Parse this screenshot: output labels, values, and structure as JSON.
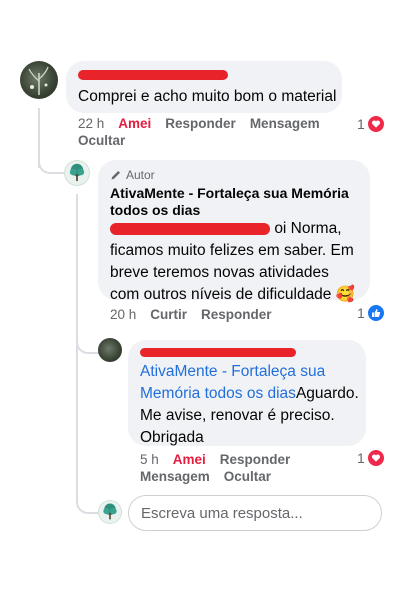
{
  "comment1": {
    "text": "Comprei e acho muito bom o material",
    "time": "22 h",
    "like_label": "Amei",
    "reply_label": "Responder",
    "message_label": "Mensagem",
    "hide_label": "Ocultar",
    "reaction_count": "1",
    "reaction_icon": "love-icon"
  },
  "reply1": {
    "badge": "Autor",
    "badge_icon": "pencil-icon",
    "author": "AtivaMente - Fortaleça sua Memória todos os dias",
    "text_line1": "oi Norma,",
    "text_rest": "ficamos muito felizes em saber. Em breve teremos novas atividades com outros níveis de dificuldade",
    "emoji": "🥰",
    "time": "20 h",
    "like_label": "Curtir",
    "reply_label": "Responder",
    "reaction_count": "1",
    "reaction_icon": "like-icon"
  },
  "reply2": {
    "mention": "AtivaMente - Fortaleça sua Memória todos os dias",
    "text": "Aguardo. Me avise, renovar é preciso. Obrigada",
    "time": "5 h",
    "like_label": "Amei",
    "reply_label": "Responder",
    "message_label": "Mensagem",
    "hide_label": "Ocultar",
    "reaction_count": "1",
    "reaction_icon": "love-icon"
  },
  "composer": {
    "placeholder": "Escreva uma resposta..."
  },
  "colors": {
    "accent_red": "#e41e3f",
    "link_blue": "#216fdb",
    "bubble_gray": "#f0f2f5"
  }
}
